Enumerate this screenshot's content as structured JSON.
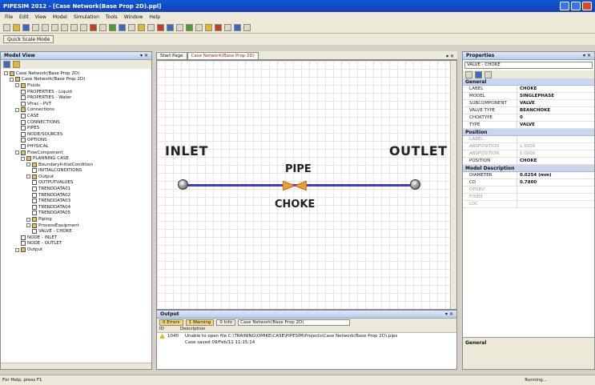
{
  "window": {
    "title": "PIPESIM 2012 - [Case Network(Base Prop 2D).ppl]"
  },
  "menu": [
    "File",
    "Edit",
    "View",
    "Model",
    "Simulation",
    "Tools",
    "Window",
    "Help"
  ],
  "toolbar2": {
    "item": "Quick Scale Mode"
  },
  "left_panel": {
    "title": "Model View",
    "tree": [
      {
        "indent": 0,
        "label": "Case Network(Base Prop 2D)",
        "icon": "folder"
      },
      {
        "indent": 1,
        "label": "Case Network(Base Prop 2D)",
        "icon": "folder"
      },
      {
        "indent": 2,
        "label": "Fluids",
        "icon": "folder"
      },
      {
        "indent": 3,
        "label": "PROPERTIES - Liquid",
        "icon": "doc"
      },
      {
        "indent": 3,
        "label": "PROPERTIES - Water",
        "icon": "doc"
      },
      {
        "indent": 3,
        "label": "Vfrac - PVT",
        "icon": "doc"
      },
      {
        "indent": 2,
        "label": "Connections",
        "icon": "folder"
      },
      {
        "indent": 3,
        "label": "CASE",
        "icon": "doc"
      },
      {
        "indent": 3,
        "label": "CONNECTIONS",
        "icon": "doc"
      },
      {
        "indent": 3,
        "label": "PIPES",
        "icon": "doc"
      },
      {
        "indent": 3,
        "label": "NODE/SOURCES",
        "icon": "doc"
      },
      {
        "indent": 3,
        "label": "OPTIONS",
        "icon": "doc"
      },
      {
        "indent": 3,
        "label": "PHYSICAL",
        "icon": "doc"
      },
      {
        "indent": 2,
        "label": "FlowComponent",
        "icon": "folder"
      },
      {
        "indent": 3,
        "label": "PLANNING CASE",
        "icon": "folder"
      },
      {
        "indent": 4,
        "label": "BoundaryInitialCondition",
        "icon": "folder"
      },
      {
        "indent": 5,
        "label": "INITIALCONDITIONS",
        "icon": "doc"
      },
      {
        "indent": 4,
        "label": "Output",
        "icon": "folder"
      },
      {
        "indent": 5,
        "label": "OUTPUTVALUES",
        "icon": "doc"
      },
      {
        "indent": 5,
        "label": "TRENDDATA01",
        "icon": "doc"
      },
      {
        "indent": 5,
        "label": "TRENDDATA02",
        "icon": "doc"
      },
      {
        "indent": 5,
        "label": "TRENDDATA03",
        "icon": "doc"
      },
      {
        "indent": 5,
        "label": "TRENDDATA04",
        "icon": "doc"
      },
      {
        "indent": 5,
        "label": "TRENDDATA05",
        "icon": "doc"
      },
      {
        "indent": 4,
        "label": "Piping",
        "icon": "folder"
      },
      {
        "indent": 4,
        "label": "ProcessEquipment",
        "icon": "folder"
      },
      {
        "indent": 5,
        "label": "VALVE - CHOKE",
        "icon": "doc"
      },
      {
        "indent": 3,
        "label": "NODE - INLET",
        "icon": "doc"
      },
      {
        "indent": 3,
        "label": "NODE - OUTLET",
        "icon": "doc"
      },
      {
        "indent": 2,
        "label": "Output",
        "icon": "folder"
      }
    ]
  },
  "editor": {
    "tabs": [
      {
        "label": "Start Page"
      },
      {
        "label": "Case Network(Base Prop 2D)"
      }
    ],
    "close": "▾ ✕",
    "diagram": {
      "inlet": "INLET",
      "outlet": "OUTLET",
      "pipe": "PIPE",
      "choke": "CHOKE",
      "node_glyph": "P"
    }
  },
  "output": {
    "title": "Output",
    "buttons": {
      "errors": "0 Errors",
      "warnings": "1 Warning",
      "info": "0 Info"
    },
    "source": "Case Network(Base Prop 2D)",
    "columns": [
      "ID",
      "Description"
    ],
    "rows": [
      {
        "id": "1040",
        "desc": "Unable to open file C:\\TRAINING\\OMIKE\\CASE\\PIPESIM\\Projects\\Case Network(Base Prop 2D).pips"
      },
      {
        "id": "",
        "desc": "Case saved 09/Feb/11 11:15:14"
      }
    ]
  },
  "properties": {
    "title": "Properties",
    "selector": "VALVE - CHOKE",
    "categories": [
      {
        "name": "General",
        "rows": [
          {
            "k": "LABEL",
            "v": "CHOKE",
            "dim": false
          },
          {
            "k": "MODEL",
            "v": "SINGLEPHASE",
            "dim": false
          },
          {
            "k": "SUBCOMPONENT",
            "v": "VALVE",
            "dim": false
          },
          {
            "k": "VALVE TYPE",
            "v": "BEANCHOKE",
            "dim": false
          },
          {
            "k": "CHOKTYPE",
            "v": "0",
            "dim": false
          },
          {
            "k": "TYPE",
            "v": "VALVE",
            "dim": false
          }
        ]
      },
      {
        "name": "Position",
        "rows": [
          {
            "k": "LABEL",
            "v": "",
            "dim": true
          },
          {
            "k": "ABSPOSITION",
            "v": "1.5000",
            "dim": true
          },
          {
            "k": "ABSPOSITION",
            "v": "1.0000",
            "dim": true
          },
          {
            "k": "POSITION",
            "v": "CHOKE",
            "dim": false
          }
        ]
      },
      {
        "name": "Model Description",
        "rows": [
          {
            "k": "DIAMETER",
            "v": "0.0254 (mm)",
            "dim": false
          },
          {
            "k": "CD",
            "v": "0.7800",
            "dim": false
          },
          {
            "k": "DPDEV",
            "v": "",
            "dim": true
          },
          {
            "k": "FIXED",
            "v": "",
            "dim": true
          },
          {
            "k": "LOC",
            "v": "",
            "dim": true
          }
        ]
      }
    ],
    "desc_title": "General"
  },
  "status": {
    "left": "For Help, press F1",
    "right": "Running..."
  }
}
